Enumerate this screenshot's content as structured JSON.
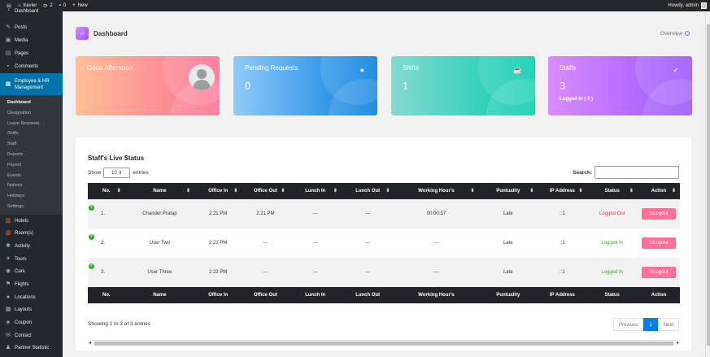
{
  "adminbar": {
    "site": "travler",
    "updates": "2",
    "comments": "0",
    "new": "New",
    "howdy": "Howdy, admin"
  },
  "sidebar": {
    "items_top": [
      {
        "label": "Dashboard",
        "icon": "gauge-icon"
      },
      {
        "label": "Posts",
        "icon": "pin-icon"
      },
      {
        "label": "Media",
        "icon": "media-icon"
      },
      {
        "label": "Pages",
        "icon": "page-icon"
      },
      {
        "label": "Comments",
        "icon": "comment-icon"
      }
    ],
    "active": {
      "label": "Employee & HR Management",
      "icon": "briefcase-icon"
    },
    "submenu": [
      "Dashboard",
      "Designation",
      "Leave Requests",
      "Shifts",
      "Staff",
      "Reports",
      "Payroll",
      "Events",
      "Notices",
      "Holidays",
      "Settings"
    ],
    "items_bottom": [
      {
        "label": "Hotels",
        "icon": "hotel-icon"
      },
      {
        "label": "Room(s)",
        "icon": "room-icon"
      },
      {
        "label": "Activity",
        "icon": "activity-icon"
      },
      {
        "label": "Tours",
        "icon": "tours-icon"
      },
      {
        "label": "Cars",
        "icon": "car-icon"
      },
      {
        "label": "Flights",
        "icon": "flag-icon"
      },
      {
        "label": "Locations",
        "icon": "location-icon"
      },
      {
        "label": "Layouts",
        "icon": "layouts-icon"
      },
      {
        "label": "Coupon",
        "icon": "coupon-icon"
      },
      {
        "label": "Contact",
        "icon": "mail-icon"
      },
      {
        "label": "Partner Statistic",
        "icon": "user-icon"
      }
    ]
  },
  "header": {
    "title": "Dashboard",
    "overview": "Overview"
  },
  "cards": [
    {
      "title": "Good Afternoon",
      "value": "",
      "sub": ""
    },
    {
      "title": "Pending Requests",
      "value": "0",
      "sub": ""
    },
    {
      "title": "Shifts",
      "value": "1",
      "sub": ""
    },
    {
      "title": "Staffs",
      "value": "3",
      "sub": "Logged in ( 3 )"
    }
  ],
  "table": {
    "title": "Staff's Live Status",
    "show_label": "Show",
    "entries_value": "10",
    "entries_label": "entries",
    "search_label": "Search:",
    "columns": [
      "No.",
      "Name",
      "Office In",
      "Office Out",
      "Lunch In",
      "Lunch Out",
      "Working Hour's",
      "Puntuality",
      "IP Address",
      "Status",
      "Action"
    ],
    "rows": [
      {
        "no": "1.",
        "name": "Chander Pratap",
        "office_in": "2:21 PM",
        "office_out": "2:21 PM",
        "lunch_in": "---",
        "lunch_out": "---",
        "working": "00:00:37",
        "punctuality": "Late",
        "ip": "::1",
        "status": "Logged Out",
        "action": "Logout"
      },
      {
        "no": "2.",
        "name": "User Two",
        "office_in": "2:22 PM",
        "office_out": "---",
        "lunch_in": "---",
        "lunch_out": "---",
        "working": "---",
        "punctuality": "Late",
        "ip": "::1",
        "status": "Logged In",
        "action": "Logout"
      },
      {
        "no": "3.",
        "name": "User Three",
        "office_in": "2:22 PM",
        "office_out": "---",
        "lunch_in": "---",
        "lunch_out": "---",
        "working": "---",
        "punctuality": "Late",
        "ip": "::1",
        "status": "Logged In",
        "action": "Logout"
      }
    ],
    "info": "Showing 1 to 3 of 3 entries",
    "pager": {
      "prev": "Previous",
      "current": "1",
      "next": "Next"
    }
  }
}
